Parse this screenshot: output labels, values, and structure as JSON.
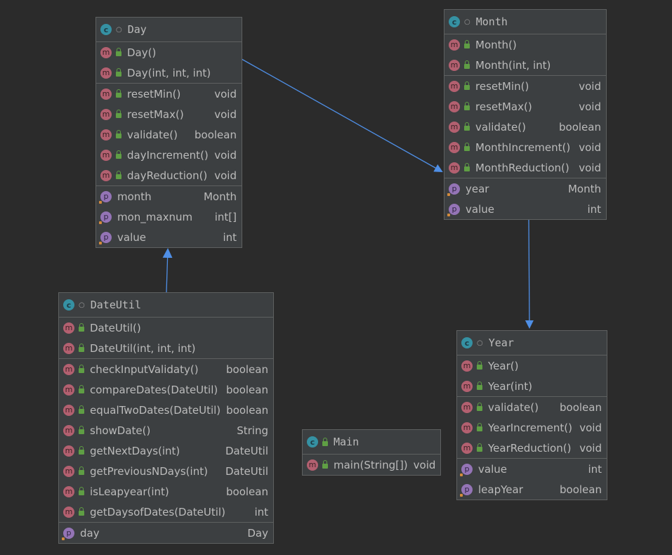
{
  "classes": {
    "day": {
      "name": "Day",
      "constructors": [
        "Day()",
        "Day(int, int, int)"
      ],
      "methods": [
        {
          "name": "resetMin()",
          "type": "void"
        },
        {
          "name": "resetMax()",
          "type": "void"
        },
        {
          "name": "validate()",
          "type": "boolean"
        },
        {
          "name": "dayIncrement()",
          "type": "void"
        },
        {
          "name": "dayReduction()",
          "type": "void"
        }
      ],
      "fields": [
        {
          "name": "month",
          "type": "Month"
        },
        {
          "name": "mon_maxnum",
          "type": "int[]"
        },
        {
          "name": "value",
          "type": "int"
        }
      ]
    },
    "month": {
      "name": "Month",
      "constructors": [
        "Month()",
        "Month(int, int)"
      ],
      "methods": [
        {
          "name": "resetMin()",
          "type": "void"
        },
        {
          "name": "resetMax()",
          "type": "void"
        },
        {
          "name": "validate()",
          "type": "boolean"
        },
        {
          "name": "MonthIncrement()",
          "type": "void"
        },
        {
          "name": "MonthReduction()",
          "type": "void"
        }
      ],
      "fields": [
        {
          "name": "year",
          "type": "Month"
        },
        {
          "name": "value",
          "type": "int"
        }
      ]
    },
    "dateutil": {
      "name": "DateUtil",
      "constructors": [
        "DateUtil()",
        "DateUtil(int, int, int)"
      ],
      "methods": [
        {
          "name": "checkInputValidaty()",
          "type": "boolean"
        },
        {
          "name": "compareDates(DateUtil)",
          "type": "boolean"
        },
        {
          "name": "equalTwoDates(DateUtil)",
          "type": "boolean"
        },
        {
          "name": "showDate()",
          "type": "String"
        },
        {
          "name": "getNextDays(int)",
          "type": "DateUtil"
        },
        {
          "name": "getPreviousNDays(int)",
          "type": "DateUtil"
        },
        {
          "name": "isLeapyear(int)",
          "type": "boolean"
        },
        {
          "name": "getDaysofDates(DateUtil)",
          "type": "int"
        }
      ],
      "fields": [
        {
          "name": "day",
          "type": "Day"
        }
      ]
    },
    "year": {
      "name": "Year",
      "constructors": [
        "Year()",
        "Year(int)"
      ],
      "methods": [
        {
          "name": "validate()",
          "type": "boolean"
        },
        {
          "name": "YearIncrement()",
          "type": "void"
        },
        {
          "name": "YearReduction()",
          "type": "void"
        }
      ],
      "fields": [
        {
          "name": "value",
          "type": "int"
        },
        {
          "name": "leapYear",
          "type": "boolean"
        }
      ]
    },
    "main": {
      "name": "Main",
      "methods": [
        {
          "name": "main(String[])",
          "type": "void"
        }
      ]
    }
  },
  "icons": {
    "class": "class-icon",
    "method": "method-icon",
    "field": "field-icon",
    "public": "public-lock-icon"
  },
  "colors": {
    "background": "#2b2b2b",
    "box": "#3c3f41",
    "border": "#5e6060",
    "arrow": "#4f8fe6",
    "method_icon": "#b36070",
    "field_icon": "#9474b6",
    "class_icon": "#3591a3"
  }
}
